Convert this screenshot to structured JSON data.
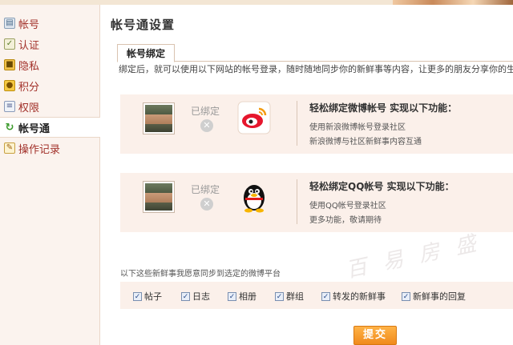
{
  "colors": {
    "accent": "#a2312a",
    "card_bg": "#fbf0ea",
    "sidebar_bg": "#fbf3ee",
    "submit": "#f08a1c"
  },
  "sidebar": {
    "items": [
      {
        "label": "帐号",
        "icon": "id-card-icon"
      },
      {
        "label": "认证",
        "icon": "certificate-icon"
      },
      {
        "label": "隐私",
        "icon": "lock-icon"
      },
      {
        "label": "积分",
        "icon": "coins-icon"
      },
      {
        "label": "权限",
        "icon": "document-icon"
      },
      {
        "label": "帐号通",
        "icon": "sync-icon",
        "active": true
      },
      {
        "label": "操作记录",
        "icon": "pencil-icon"
      }
    ]
  },
  "main": {
    "title": "帐号通设置",
    "tab": "帐号绑定",
    "description": "绑定后，就可以使用以下网站的帐号登录，随时随地同步你的新鲜事等内容，让更多的朋友分享你的生活！"
  },
  "bindings": {
    "weibo": {
      "status": "已绑定",
      "logo": "sina-weibo-logo",
      "title": "轻松绑定微博帐号 实现以下功能：",
      "features": [
        "使用新浪微博帐号登录社区",
        "新浪微博与社区新鲜事内容互通"
      ]
    },
    "qq": {
      "status": "已绑定",
      "logo": "qq-penguin-logo",
      "title": "轻松绑定QQ帐号 实现以下功能：",
      "features": [
        "使用QQ帐号登录社区",
        "更多功能，敬请期待"
      ]
    }
  },
  "sync": {
    "label": "以下这些新鲜事我愿意同步到选定的微博平台",
    "options": [
      {
        "label": "帖子",
        "checked": true
      },
      {
        "label": "日志",
        "checked": true
      },
      {
        "label": "相册",
        "checked": true
      },
      {
        "label": "群组",
        "checked": true
      },
      {
        "label": "转发的新鲜事",
        "checked": true
      },
      {
        "label": "新鲜事的回复",
        "checked": true
      }
    ]
  },
  "submit_label": "提交",
  "watermark_text": "百 易 房 盛"
}
